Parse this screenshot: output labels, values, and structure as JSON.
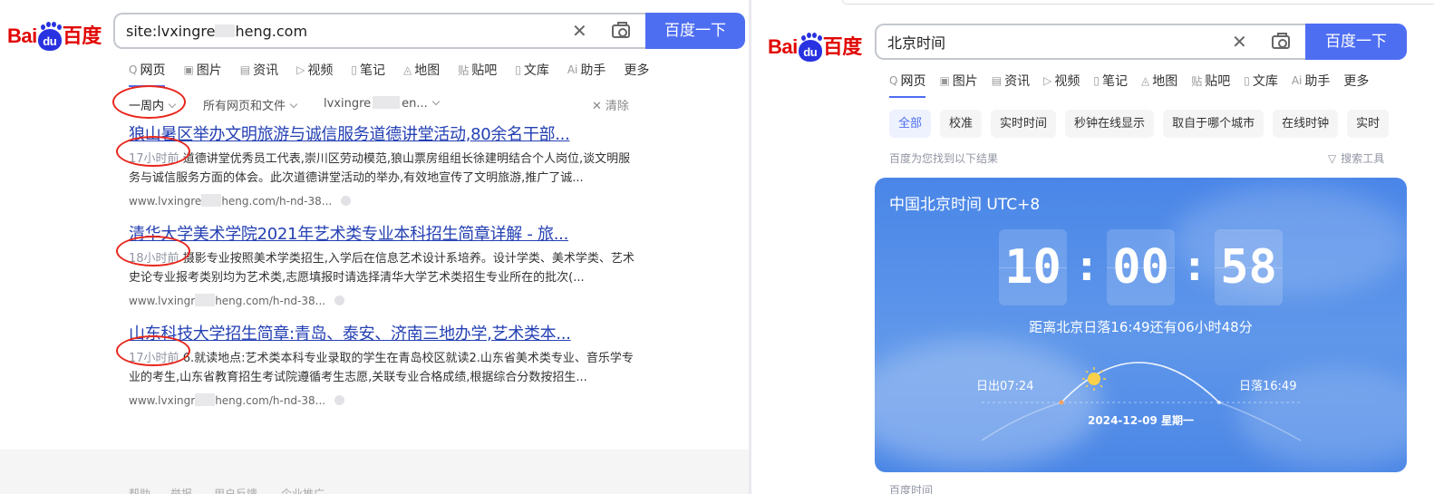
{
  "left": {
    "logo": {
      "bai": "Bai",
      "du": "du",
      "text": "百度"
    },
    "search": {
      "value": "site:lvxingre",
      "value_tail": "heng.com",
      "button": "百度一下"
    },
    "tabs": [
      {
        "icon": "Q",
        "label": "网页"
      },
      {
        "icon": "▣",
        "label": "图片"
      },
      {
        "icon": "▤",
        "label": "资讯"
      },
      {
        "icon": "▷",
        "label": "视频"
      },
      {
        "icon": "▯",
        "label": "笔记"
      },
      {
        "icon": "◬",
        "label": "地图"
      },
      {
        "icon": "贴",
        "label": "贴吧"
      },
      {
        "icon": "▯",
        "label": "文库"
      },
      {
        "icon": "Ai",
        "label": "助手"
      },
      {
        "icon": "",
        "label": "更多"
      }
    ],
    "filters": {
      "time": "一周内",
      "type": "所有网页和文件",
      "site_a": "lvxingre",
      "site_b": "en...",
      "clear": "清除"
    },
    "results": [
      {
        "title": "狼山暑区举办文明旅游与诚信服务道德讲堂活动,80余名干部...",
        "time": "17小时前",
        "desc": "道德讲堂优秀员工代表,崇川区劳动模范,狼山票房组组长徐建明结合个人岗位,谈文明服务与诚信服务方面的体会。此次道德讲堂活动的举办,有效地宣传了文明旅游,推广了诚...",
        "url_a": "www.lvxingre",
        "url_b": "heng.com/h-nd-38..."
      },
      {
        "title": "清华大学美术学院2021年艺术类专业本科招生简章详解 - 旅...",
        "time": "18小时前",
        "desc": "摄影专业按照美术学类招生,入学后在信息艺术设计系培养。设计学类、美术学类、艺术史论专业报考类别均为艺术类,志愿填报时请选择清华大学艺术类招生专业所在的批次(...",
        "url_a": "www.lvxingr",
        "url_b": "heng.com/h-nd-38..."
      },
      {
        "title": "山东科技大学招生简章:青岛、泰安、济南三地办学,艺术类本...",
        "time": "17小时前",
        "desc": "6.就读地点:艺术类本科专业录取的学生在青岛校区就读2.山东省美术类专业、音乐学专业的考生,山东省教育招生考试院遵循考生志愿,关联专业合格成绩,根据综合分数按招生...",
        "url_a": "www.lvxingr",
        "url_b": "heng.com/h-nd-38..."
      }
    ],
    "footer": [
      "帮助",
      "举报",
      "用户反馈",
      "企业推广"
    ]
  },
  "right": {
    "logo": {
      "bai": "Bai",
      "du": "du",
      "text": "百度"
    },
    "search": {
      "value": "北京时间",
      "button": "百度一下"
    },
    "tabs": [
      {
        "icon": "Q",
        "label": "网页"
      },
      {
        "icon": "▣",
        "label": "图片"
      },
      {
        "icon": "▤",
        "label": "资讯"
      },
      {
        "icon": "▷",
        "label": "视频"
      },
      {
        "icon": "▯",
        "label": "笔记"
      },
      {
        "icon": "◬",
        "label": "地图"
      },
      {
        "icon": "贴",
        "label": "贴吧"
      },
      {
        "icon": "▯",
        "label": "文库"
      },
      {
        "icon": "Ai",
        "label": "助手"
      },
      {
        "icon": "",
        "label": "更多"
      }
    ],
    "chips": [
      "全部",
      "校准",
      "实时时间",
      "秒钟在线显示",
      "取自于哪个城市",
      "在线时钟",
      "实时"
    ],
    "found": "百度为您找到以下结果",
    "tools": "搜索工具",
    "card": {
      "title": "中国北京时间 UTC+8",
      "hh": "10",
      "mm": "00",
      "ss": "58",
      "colon": ":",
      "sunset_text": "距离北京日落16:49还有06小时48分",
      "sunrise": "日出07:24",
      "sunset": "日落16:49",
      "date": "2024-12-09   星期一"
    },
    "peek": "百度时间"
  },
  "colors": {
    "accent": "#4e6ef2",
    "link": "#2440b3",
    "logo_red": "#e10602",
    "logo_blue": "#2932e1",
    "annotation_ring": "#e8261c",
    "card_blue": "#4a86e8"
  }
}
